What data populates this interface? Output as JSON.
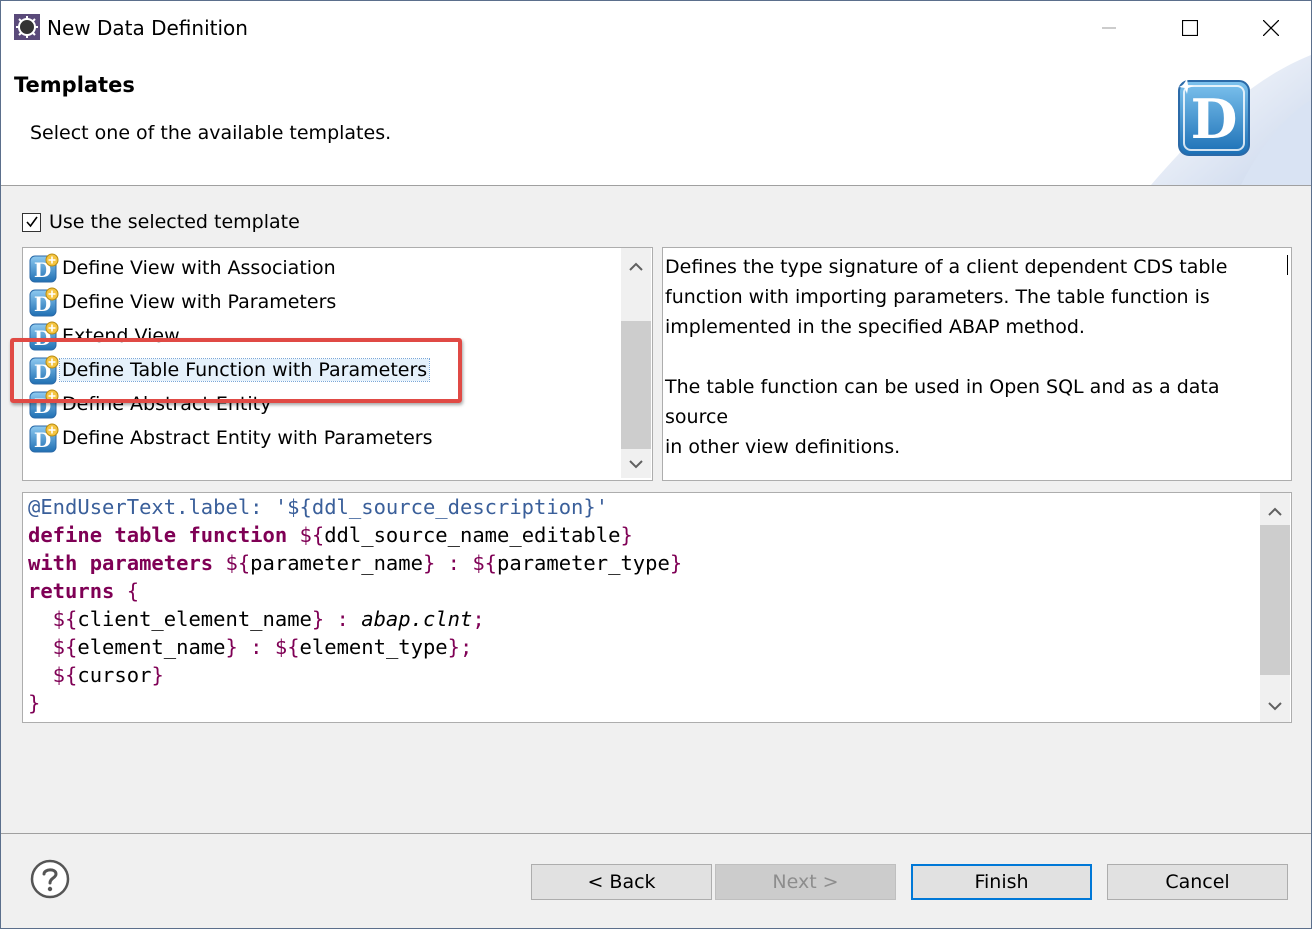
{
  "window": {
    "title": "New Data Definition",
    "controls": [
      "minimize-icon",
      "maximize-icon",
      "close-icon"
    ]
  },
  "banner": {
    "title": "Templates",
    "message": "Select one of the available templates.",
    "logo_letter": "D"
  },
  "use_template": {
    "label": "Use the selected template",
    "checked": true
  },
  "templates": {
    "items": [
      {
        "label": "Define View with Association",
        "icon": "ddl-template-icon"
      },
      {
        "label": "Define View with Parameters",
        "icon": "ddl-template-icon"
      },
      {
        "label": "Extend View",
        "icon": "ddl-template-icon"
      },
      {
        "label": "Define Table Function with Parameters",
        "icon": "ddl-template-icon",
        "selected": true
      },
      {
        "label": "Define Abstract Entity",
        "icon": "ddl-template-icon"
      },
      {
        "label": "Define Abstract Entity with Parameters",
        "icon": "ddl-template-icon"
      }
    ],
    "highlight_color": "#e04a45"
  },
  "description": {
    "text": "Defines the type signature of a client dependent CDS table\nfunction with importing parameters. The table function is\nimplemented in the specified ABAP method.\n\nThe table function can be used in Open SQL and as a data source\nin other view definitions."
  },
  "code": {
    "lines": [
      [
        {
          "t": "@EndUserText.label: '${ddl_source_description}'",
          "c": "ann"
        }
      ],
      [
        {
          "t": "define table function",
          "c": "kw"
        },
        {
          "t": " ",
          "c": ""
        },
        {
          "t": "${",
          "c": "var"
        },
        {
          "t": "ddl_source_name_editable",
          "c": ""
        },
        {
          "t": "}",
          "c": "var"
        }
      ],
      [
        {
          "t": "with parameters",
          "c": "kw"
        },
        {
          "t": " ",
          "c": ""
        },
        {
          "t": "${",
          "c": "var"
        },
        {
          "t": "parameter_name",
          "c": ""
        },
        {
          "t": "}",
          "c": "var"
        },
        {
          "t": " : ",
          "c": "var"
        },
        {
          "t": "${",
          "c": "var"
        },
        {
          "t": "parameter_type",
          "c": ""
        },
        {
          "t": "}",
          "c": "var"
        }
      ],
      [
        {
          "t": "returns",
          "c": "kw"
        },
        {
          "t": " {",
          "c": "var"
        }
      ],
      [
        {
          "t": "  ${",
          "c": "var"
        },
        {
          "t": "client_element_name",
          "c": ""
        },
        {
          "t": "}",
          "c": "var"
        },
        {
          "t": " : ",
          "c": "var"
        },
        {
          "t": "abap.clnt",
          "c": "it"
        },
        {
          "t": ";",
          "c": "var"
        }
      ],
      [
        {
          "t": "  ${",
          "c": "var"
        },
        {
          "t": "element_name",
          "c": ""
        },
        {
          "t": "}",
          "c": "var"
        },
        {
          "t": " : ",
          "c": "var"
        },
        {
          "t": "${",
          "c": "var"
        },
        {
          "t": "element_type",
          "c": ""
        },
        {
          "t": "};",
          "c": "var"
        }
      ],
      [
        {
          "t": "  ${",
          "c": "var"
        },
        {
          "t": "cursor",
          "c": ""
        },
        {
          "t": "}",
          "c": "var"
        }
      ],
      [
        {
          "t": "}",
          "c": "var"
        }
      ]
    ]
  },
  "buttons": {
    "help_icon": "help-icon",
    "back_label": "< Back",
    "next_label": "Next >",
    "finish_label": "Finish",
    "cancel_label": "Cancel"
  }
}
